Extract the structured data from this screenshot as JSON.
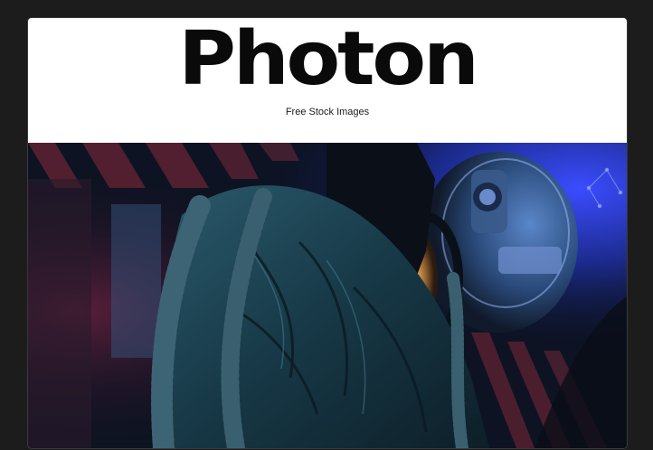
{
  "header": {
    "logo_text": "Photon",
    "tagline": "Free Stock Images"
  },
  "hero": {
    "image_name": "astronaut-photo",
    "colors": {
      "shadow": "#0b1018",
      "blue_glow": "#2a3cff",
      "red_stripe": "#a32a3a",
      "suit_teal": "#1f4a5c",
      "visor_gold": "#c98a3a"
    }
  }
}
